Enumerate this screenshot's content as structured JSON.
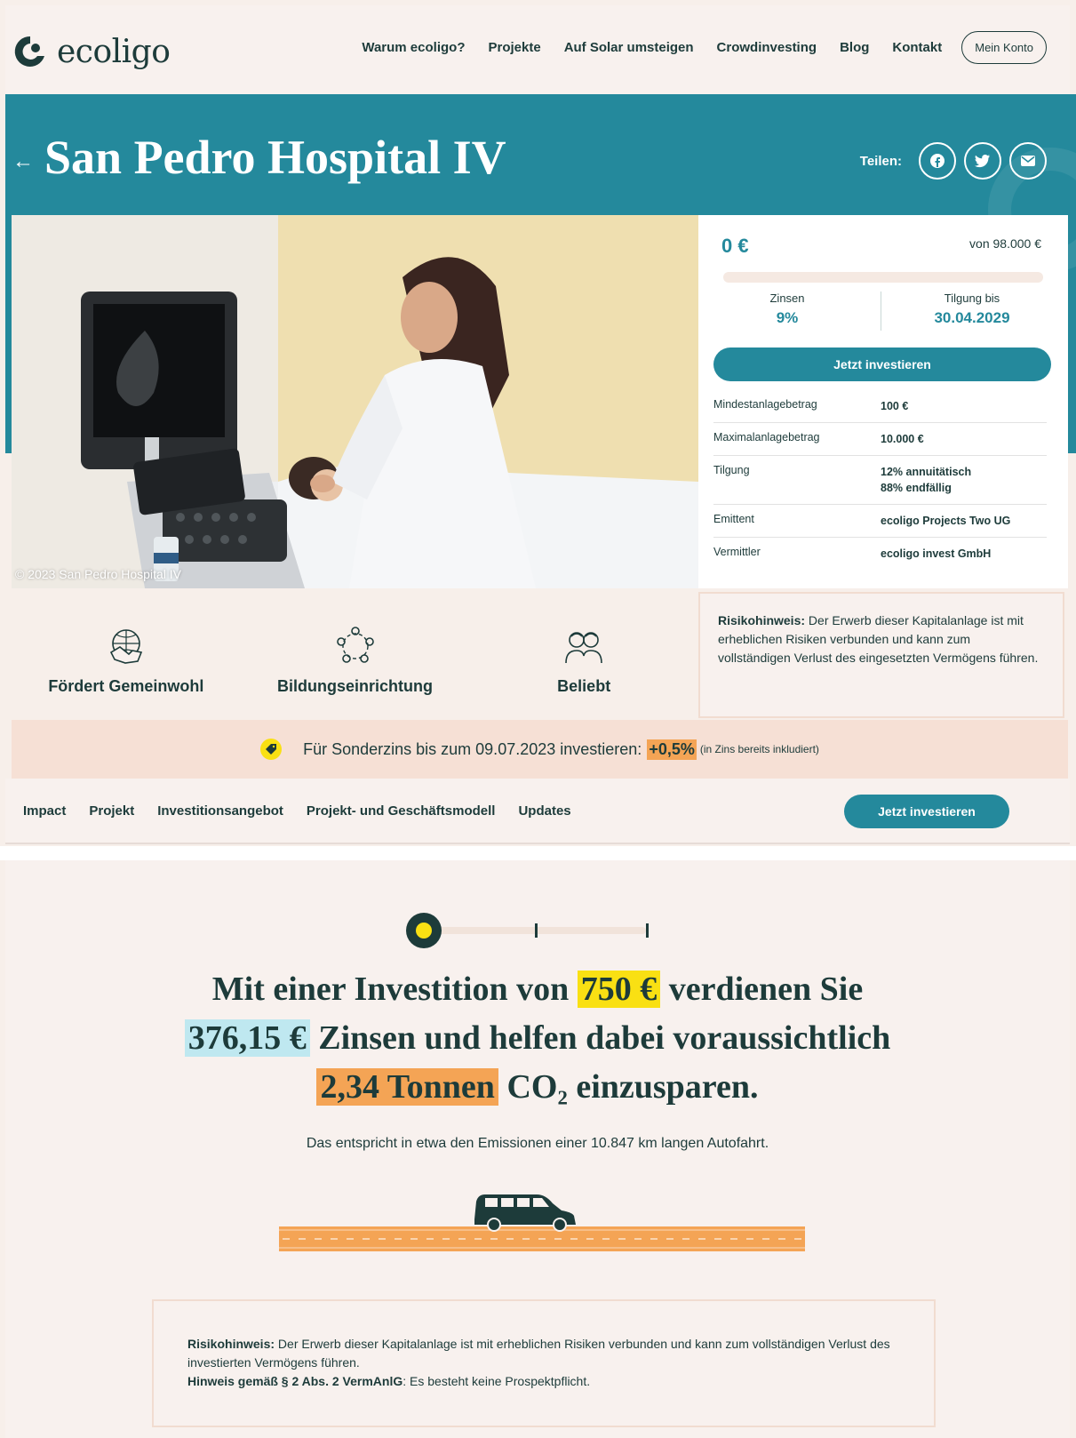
{
  "header": {
    "logo_text": "ecoligo",
    "nav": [
      "Warum ecoligo?",
      "Projekte",
      "Auf Solar umsteigen",
      "Crowdinvesting",
      "Blog",
      "Kontakt"
    ],
    "account_label": "Mein Konto"
  },
  "project": {
    "title": "San Pedro Hospital IV",
    "share_label": "Teilen:",
    "share_icons": [
      "facebook-icon",
      "twitter-icon",
      "mail-icon"
    ],
    "photo_caption": "© 2023 San Pedro Hospital IV"
  },
  "investment": {
    "amount": "0 €",
    "of_total": "von 98.000 €",
    "progress": 0,
    "interest_label": "Zinsen",
    "interest_value": "9%",
    "repayment_label": "Tilgung bis",
    "repayment_value": "30.04.2029",
    "cta": "Jetzt investieren",
    "details": [
      {
        "key": "Mindestanlagebetrag",
        "value": "100 €"
      },
      {
        "key": "Maximalanlagebetrag",
        "value": "10.000 €"
      },
      {
        "key": "Tilgung",
        "value": "12% annuitätisch",
        "value2": "88% endfällig"
      },
      {
        "key": "Emittent",
        "value": "ecoligo Projects Two UG"
      },
      {
        "key": "Vermittler",
        "value": "ecoligo invest GmbH"
      }
    ]
  },
  "features": [
    {
      "icon": "handshake-globe-icon",
      "label": "Fördert Gemeinwohl"
    },
    {
      "icon": "people-circle-icon",
      "label": "Bildungseinrichtung"
    },
    {
      "icon": "people-pair-icon",
      "label": "Beliebt"
    }
  ],
  "risk": {
    "label": "Risikohinweis:",
    "text": " Der Erwerb dieser Kapitalanlage ist mit erheblichen Risiken verbunden und kann zum vollständigen Verlust des eingesetzten Vermögens führen."
  },
  "promo": {
    "text": "Für Sonderzins bis zum 09.07.2023 investieren:",
    "bonus": "+0,5%",
    "note": "(in Zins bereits inkludiert)"
  },
  "subnav": {
    "links": [
      "Impact",
      "Projekt",
      "Investitionsangebot",
      "Projekt- und Geschäftsmodell",
      "Updates"
    ],
    "cta": "Jetzt investieren"
  },
  "impact": {
    "slider_position": 0,
    "line1_pre": "Mit einer Investition von",
    "amount": "750 €",
    "line1_post": "verdienen Sie",
    "interest": "376,15 €",
    "line2_post": "Zinsen und helfen dabei voraussichtlich",
    "co2": "2,34 Tonnen",
    "line3_post": "CO₂ einzusparen.",
    "equivalent": "Das entspricht in etwa den Emissionen einer 10.847 km langen Autofahrt."
  },
  "risk2": {
    "label": "Risikohinweis:",
    "text": " Der Erwerb dieser Kapitalanlage ist mit erheblichen Risiken verbunden und kann zum vollständigen Verlust des investierten Vermögens führen.",
    "label2": "Hinweis gemäß § 2 Abs. 2 VermAnlG",
    "text2": ": Es besteht keine Prospektpflicht."
  },
  "colors": {
    "brand_teal": "#24899c",
    "dark_green": "#1d3b3a",
    "highlight_yellow": "#f9e013",
    "highlight_blue": "#bfe8f0",
    "highlight_orange": "#f4a455"
  }
}
